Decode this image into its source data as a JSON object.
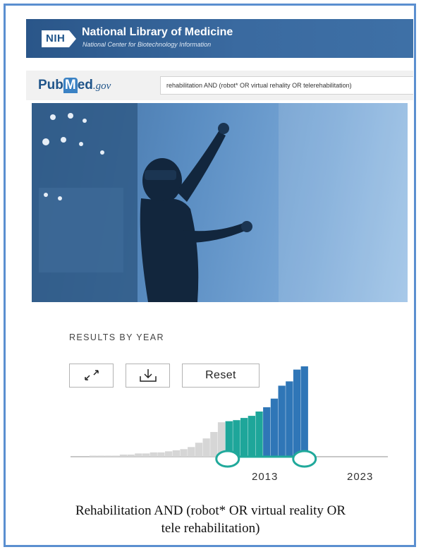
{
  "header": {
    "nih_badge": "NIH",
    "nih_title": "National Library of Medicine",
    "nih_subtitle": "National Center for Biotechnology Information"
  },
  "pubmed": {
    "logo_pub": "Pub",
    "logo_m": "M",
    "logo_ed": "ed",
    "logo_gov": ".gov",
    "search_query": "rehabilitation AND (robot* OR virtual rehality OR telerehabilitation)"
  },
  "results": {
    "title": "RESULTS BY YEAR",
    "expand_icon": "expand-icon",
    "download_icon": "download-icon",
    "reset_label": "Reset",
    "range_start": "2013",
    "range_end": "2023",
    "colors": {
      "gray": "#d6d6d6",
      "teal": "#1ea69a",
      "blue": "#2f76b7",
      "handle": "#20a99b"
    }
  },
  "chart_data": {
    "type": "bar",
    "title": "",
    "xlabel": "",
    "ylabel": "",
    "selected_range": [
      "2013",
      "2023"
    ],
    "values": [
      1,
      1,
      1,
      1,
      2,
      2,
      3,
      3,
      4,
      4,
      5,
      6,
      7,
      9,
      13,
      17,
      23,
      32,
      33,
      34,
      36,
      38,
      42,
      46,
      54,
      66,
      70,
      81,
      84
    ],
    "selected_start_index": 18
  },
  "caption": {
    "line1": "Rehabilitation AND (robot* OR virtual reality OR",
    "line2": "tele rehabilitation)"
  }
}
